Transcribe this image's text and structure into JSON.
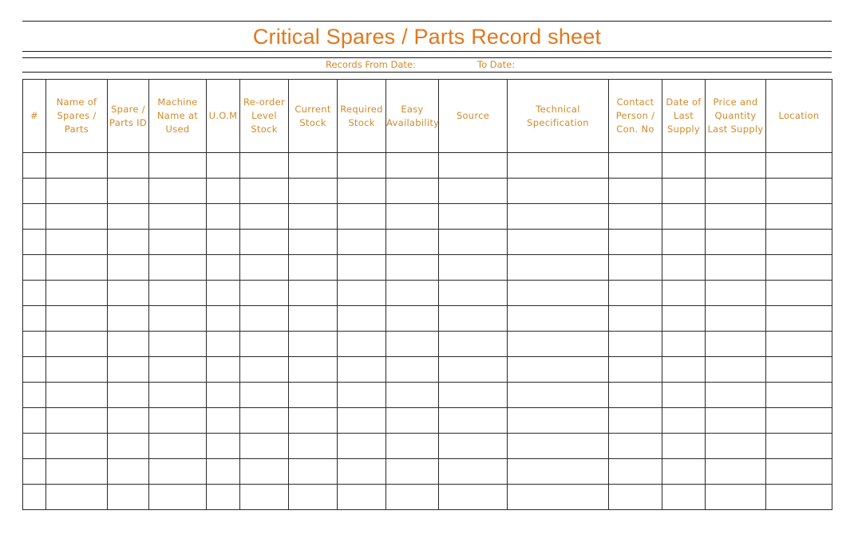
{
  "document": {
    "title": "Critical Spares / Parts Record sheet",
    "records_from_date_label": "Records From Date:",
    "records_from_date_value": "",
    "to_date_label": "To Date:",
    "to_date_value": ""
  },
  "table": {
    "columns": [
      {
        "key": "num",
        "label": "#"
      },
      {
        "key": "name",
        "label": "Name of\nSpares /\nParts"
      },
      {
        "key": "part_id",
        "label": "Spare /\nParts ID"
      },
      {
        "key": "machine",
        "label": "Machine\nName at\nUsed"
      },
      {
        "key": "uom",
        "label": "U.O.M"
      },
      {
        "key": "reorder",
        "label": "Re-order\nLevel\nStock"
      },
      {
        "key": "current",
        "label": "Current\nStock"
      },
      {
        "key": "required",
        "label": "Required\nStock"
      },
      {
        "key": "availability",
        "label": "Easy\nAvailability"
      },
      {
        "key": "source",
        "label": "Source"
      },
      {
        "key": "tech_spec",
        "label": "Technical\nSpecification"
      },
      {
        "key": "contact",
        "label": "Contact\nPerson /\nCon. No"
      },
      {
        "key": "last_date",
        "label": "Date of\nLast\nSupply"
      },
      {
        "key": "price_qty",
        "label": "Price and\nQuantity\nLast Supply"
      },
      {
        "key": "location",
        "label": "Location"
      }
    ],
    "rows": [
      [
        "",
        "",
        "",
        "",
        "",
        "",
        "",
        "",
        "",
        "",
        "",
        "",
        "",
        "",
        ""
      ],
      [
        "",
        "",
        "",
        "",
        "",
        "",
        "",
        "",
        "",
        "",
        "",
        "",
        "",
        "",
        ""
      ],
      [
        "",
        "",
        "",
        "",
        "",
        "",
        "",
        "",
        "",
        "",
        "",
        "",
        "",
        "",
        ""
      ],
      [
        "",
        "",
        "",
        "",
        "",
        "",
        "",
        "",
        "",
        "",
        "",
        "",
        "",
        "",
        ""
      ],
      [
        "",
        "",
        "",
        "",
        "",
        "",
        "",
        "",
        "",
        "",
        "",
        "",
        "",
        "",
        ""
      ],
      [
        "",
        "",
        "",
        "",
        "",
        "",
        "",
        "",
        "",
        "",
        "",
        "",
        "",
        "",
        ""
      ],
      [
        "",
        "",
        "",
        "",
        "",
        "",
        "",
        "",
        "",
        "",
        "",
        "",
        "",
        "",
        ""
      ],
      [
        "",
        "",
        "",
        "",
        "",
        "",
        "",
        "",
        "",
        "",
        "",
        "",
        "",
        "",
        ""
      ],
      [
        "",
        "",
        "",
        "",
        "",
        "",
        "",
        "",
        "",
        "",
        "",
        "",
        "",
        "",
        ""
      ],
      [
        "",
        "",
        "",
        "",
        "",
        "",
        "",
        "",
        "",
        "",
        "",
        "",
        "",
        "",
        ""
      ],
      [
        "",
        "",
        "",
        "",
        "",
        "",
        "",
        "",
        "",
        "",
        "",
        "",
        "",
        "",
        ""
      ],
      [
        "",
        "",
        "",
        "",
        "",
        "",
        "",
        "",
        "",
        "",
        "",
        "",
        "",
        "",
        ""
      ],
      [
        "",
        "",
        "",
        "",
        "",
        "",
        "",
        "",
        "",
        "",
        "",
        "",
        "",
        "",
        ""
      ],
      [
        "",
        "",
        "",
        "",
        "",
        "",
        "",
        "",
        "",
        "",
        "",
        "",
        "",
        "",
        ""
      ]
    ]
  },
  "colors": {
    "title": "#e0781e",
    "label": "#d48a2a",
    "grid": "#2a2a2a"
  }
}
